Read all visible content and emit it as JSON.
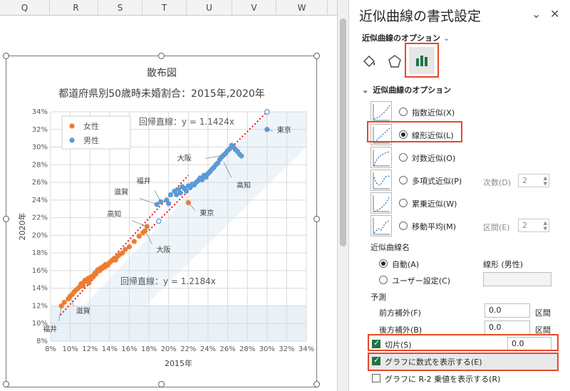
{
  "sheet": {
    "columns": [
      "Q",
      "R",
      "S",
      "T",
      "U",
      "V",
      "W"
    ]
  },
  "chart_data": {
    "type": "scatter",
    "title": "散布図",
    "subtitle": "都道府県別50歳時未婚割合：2015年,2020年",
    "xlabel": "2015年",
    "ylabel": "2020年",
    "xlim": [
      0.08,
      0.34
    ],
    "ylim": [
      0.08,
      0.34
    ],
    "x_ticks": [
      "8%",
      "10%",
      "12%",
      "14%",
      "16%",
      "18%",
      "20%",
      "22%",
      "24%",
      "26%",
      "28%",
      "30%",
      "32%",
      "34%"
    ],
    "y_ticks": [
      "8%",
      "10%",
      "12%",
      "14%",
      "16%",
      "18%",
      "20%",
      "22%",
      "24%",
      "26%",
      "28%",
      "30%",
      "32%",
      "34%"
    ],
    "grid": true,
    "legend_position": "top-left",
    "series": [
      {
        "name": "女性",
        "color": "#ed7d31",
        "points": [
          [
            0.091,
            0.12
          ],
          [
            0.094,
            0.124
          ],
          [
            0.098,
            0.128
          ],
          [
            0.1,
            0.131
          ],
          [
            0.102,
            0.133
          ],
          [
            0.104,
            0.136
          ],
          [
            0.106,
            0.138
          ],
          [
            0.108,
            0.14
          ],
          [
            0.11,
            0.142
          ],
          [
            0.111,
            0.145
          ],
          [
            0.113,
            0.143
          ],
          [
            0.114,
            0.147
          ],
          [
            0.115,
            0.149
          ],
          [
            0.117,
            0.148
          ],
          [
            0.118,
            0.151
          ],
          [
            0.119,
            0.146
          ],
          [
            0.12,
            0.15
          ],
          [
            0.121,
            0.153
          ],
          [
            0.122,
            0.152
          ],
          [
            0.124,
            0.155
          ],
          [
            0.125,
            0.157
          ],
          [
            0.126,
            0.156
          ],
          [
            0.127,
            0.159
          ],
          [
            0.128,
            0.161
          ],
          [
            0.13,
            0.16
          ],
          [
            0.131,
            0.163
          ],
          [
            0.132,
            0.162
          ],
          [
            0.134,
            0.165
          ],
          [
            0.135,
            0.164
          ],
          [
            0.136,
            0.167
          ],
          [
            0.138,
            0.166
          ],
          [
            0.14,
            0.169
          ],
          [
            0.142,
            0.171
          ],
          [
            0.144,
            0.173
          ],
          [
            0.146,
            0.172
          ],
          [
            0.148,
            0.176
          ],
          [
            0.15,
            0.178
          ],
          [
            0.153,
            0.18
          ],
          [
            0.156,
            0.184
          ],
          [
            0.16,
            0.187
          ],
          [
            0.165,
            0.193
          ],
          [
            0.17,
            0.199
          ],
          [
            0.174,
            0.203
          ],
          [
            0.176,
            0.205
          ],
          [
            0.178,
            0.21
          ],
          [
            0.22,
            0.237
          ]
        ]
      },
      {
        "name": "男性",
        "color": "#5b9bd5",
        "points": [
          [
            0.188,
            0.235
          ],
          [
            0.192,
            0.238
          ],
          [
            0.198,
            0.24
          ],
          [
            0.2,
            0.236
          ],
          [
            0.202,
            0.246
          ],
          [
            0.206,
            0.25
          ],
          [
            0.208,
            0.246
          ],
          [
            0.21,
            0.252
          ],
          [
            0.212,
            0.248
          ],
          [
            0.214,
            0.255
          ],
          [
            0.216,
            0.253
          ],
          [
            0.218,
            0.25
          ],
          [
            0.22,
            0.256
          ],
          [
            0.222,
            0.254
          ],
          [
            0.224,
            0.258
          ],
          [
            0.226,
            0.257
          ],
          [
            0.228,
            0.26
          ],
          [
            0.23,
            0.262
          ],
          [
            0.232,
            0.265
          ],
          [
            0.234,
            0.263
          ],
          [
            0.236,
            0.268
          ],
          [
            0.238,
            0.266
          ],
          [
            0.24,
            0.27
          ],
          [
            0.242,
            0.272
          ],
          [
            0.244,
            0.275
          ],
          [
            0.246,
            0.277
          ],
          [
            0.248,
            0.28
          ],
          [
            0.25,
            0.282
          ],
          [
            0.252,
            0.286
          ],
          [
            0.254,
            0.289
          ],
          [
            0.256,
            0.291
          ],
          [
            0.258,
            0.293
          ],
          [
            0.26,
            0.296
          ],
          [
            0.262,
            0.298
          ],
          [
            0.264,
            0.302
          ],
          [
            0.266,
            0.3
          ],
          [
            0.268,
            0.297
          ],
          [
            0.27,
            0.295
          ],
          [
            0.272,
            0.292
          ],
          [
            0.274,
            0.29
          ],
          [
            0.3,
            0.32
          ]
        ]
      }
    ],
    "trendlines": [
      {
        "series": "女性",
        "equation": "回帰直線：y = 1.2184x",
        "slope": 1.2184,
        "x_range": [
          0.09,
          0.22
        ]
      },
      {
        "series": "男性",
        "equation": "回帰直線：y = 1.1424x",
        "slope": 1.1424,
        "x_range": [
          0.18,
          0.3
        ]
      }
    ],
    "annotations": [
      {
        "text": "東京",
        "x": 0.3,
        "y": 0.32
      },
      {
        "text": "大阪",
        "x": 0.258,
        "y": 0.291
      },
      {
        "text": "高知",
        "x": 0.256,
        "y": 0.283
      },
      {
        "text": "福井",
        "x": 0.192,
        "y": 0.238
      },
      {
        "text": "滋賀",
        "x": 0.188,
        "y": 0.235
      },
      {
        "text": "東京",
        "x": 0.22,
        "y": 0.237
      },
      {
        "text": "高知",
        "x": 0.178,
        "y": 0.21
      },
      {
        "text": "大阪",
        "x": 0.176,
        "y": 0.205
      },
      {
        "text": "滋賀",
        "x": 0.1,
        "y": 0.131
      },
      {
        "text": "福井",
        "x": 0.091,
        "y": 0.12
      }
    ],
    "hollow_points": [
      {
        "series": "男性",
        "x": 0.3,
        "y": 0.34
      },
      {
        "series": "男性",
        "x": 0.19,
        "y": 0.216
      }
    ]
  },
  "pane": {
    "title": "近似曲線の書式設定",
    "dropdown_label": "近似曲線のオプション",
    "section_label": "近似曲線のオプション",
    "options": [
      {
        "label": "指数近似(X)",
        "selected": false
      },
      {
        "label": "線形近似(L)",
        "selected": true
      },
      {
        "label": "対数近似(O)",
        "selected": false
      },
      {
        "label": "多項式近似(P)",
        "selected": false
      },
      {
        "label": "累乗近似(W)",
        "selected": false
      },
      {
        "label": "移動平均(M)",
        "selected": false
      }
    ],
    "order_label": "次数(D)",
    "order_value": "2",
    "period_label": "区間(E)",
    "period_value": "2",
    "name_label": "近似曲線名",
    "auto_label": "自動(A)",
    "auto_value": "線形 (男性)",
    "custom_label": "ユーザー設定(C)",
    "forecast_label": "予測",
    "forward_label": "前方補外(F)",
    "forward_value": "0.0",
    "forward_unit": "区間",
    "backward_label": "後方補外(B)",
    "backward_value": "0.0",
    "backward_unit": "区間",
    "intercept_label": "切片(S)",
    "intercept_value": "0.0",
    "display_equation_label": "グラフに数式を表示する(E)",
    "display_r2_label": "グラフに R-2 乗値を表示する(R)"
  }
}
